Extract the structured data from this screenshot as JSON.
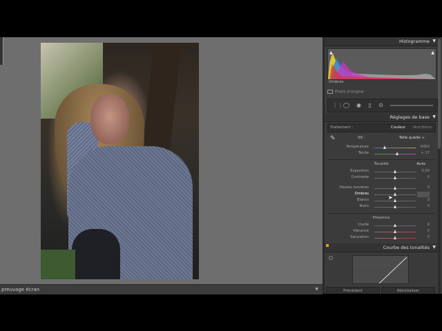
{
  "bottom": {
    "label": "preuvage écran"
  },
  "histogram": {
    "header": "Histogramme",
    "shadows_label": "Ombres",
    "original_photo": "Photo d'origine"
  },
  "basic": {
    "header": "Réglages de base",
    "treatment_label": "Traitement :",
    "treatment_color": "Couleur",
    "treatment_bw": "Noir/blanc",
    "wb_label": "BB :",
    "wb_value": "Telle quelle ÷",
    "temperature": {
      "label": "Température",
      "value": "4450",
      "position": 0.25
    },
    "tint": {
      "label": "Teinte",
      "value": "+ 17",
      "position": 0.55
    },
    "tone_title": "Tonalité",
    "auto": "Auto",
    "exposure": {
      "label": "Exposition",
      "value": "0,00",
      "position": 0.5
    },
    "contrast": {
      "label": "Contraste",
      "value": "0",
      "position": 0.5
    },
    "highlights": {
      "label": "Hautes lumières",
      "value": "0",
      "position": 0.5
    },
    "shadows": {
      "label": "Ombres",
      "value": "",
      "position": 0.5
    },
    "whites": {
      "label": "Blancs",
      "value": "0",
      "position": 0.5
    },
    "blacks": {
      "label": "Noirs",
      "value": "0",
      "position": 0.5
    },
    "presence_title": "Présence",
    "clarity": {
      "label": "Clarté",
      "value": "0",
      "position": 0.5
    },
    "vibrance": {
      "label": "Vibrance",
      "value": "0",
      "position": 0.5
    },
    "saturation": {
      "label": "Saturation",
      "value": "0",
      "position": 0.5
    }
  },
  "curve": {
    "header": "Courbe des tonalités"
  },
  "buttons": {
    "previous": "Précédent",
    "reset": "Réinitialiser"
  }
}
